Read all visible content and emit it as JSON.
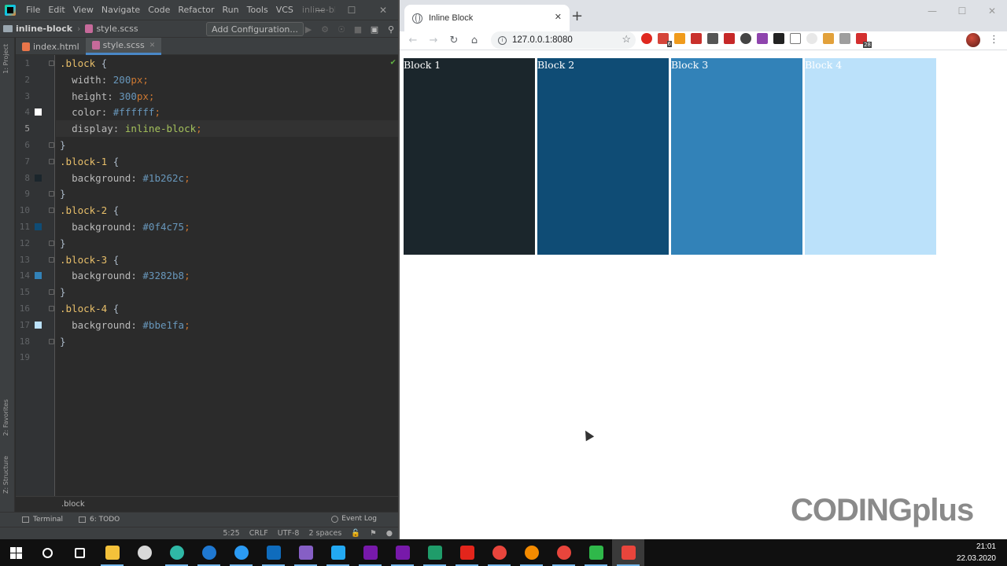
{
  "ide": {
    "menu": [
      "File",
      "Edit",
      "View",
      "Navigate",
      "Code",
      "Refactor",
      "Run",
      "Tools",
      "VCS"
    ],
    "project_title": "inline-bloc",
    "breadcrumb": {
      "project": "inline-block",
      "file": "style.scss"
    },
    "add_configuration": "Add Configuration...",
    "tabs": [
      {
        "label": "index.html",
        "active": false
      },
      {
        "label": "style.scss",
        "active": true
      }
    ],
    "side_tabs": {
      "project": "1: Project",
      "favorites": "2: Favorites",
      "structure": "Z: Structure"
    },
    "code_lines": [
      {
        "n": "1",
        "text": ".block {"
      },
      {
        "n": "2",
        "text": "  width: 200px;"
      },
      {
        "n": "3",
        "text": "  height: 300px;"
      },
      {
        "n": "4",
        "text": "  color: #ffffff;"
      },
      {
        "n": "5",
        "text": "  display: inline-block;"
      },
      {
        "n": "6",
        "text": "}"
      },
      {
        "n": "7",
        "text": ".block-1 {"
      },
      {
        "n": "8",
        "text": "  background: #1b262c;"
      },
      {
        "n": "9",
        "text": "}"
      },
      {
        "n": "10",
        "text": ".block-2 {"
      },
      {
        "n": "11",
        "text": "  background: #0f4c75;"
      },
      {
        "n": "12",
        "text": "}"
      },
      {
        "n": "13",
        "text": ".block-3 {"
      },
      {
        "n": "14",
        "text": "  background: #3282b8;"
      },
      {
        "n": "15",
        "text": "}"
      },
      {
        "n": "16",
        "text": ".block-4 {"
      },
      {
        "n": "17",
        "text": "  background: #bbe1fa;"
      },
      {
        "n": "18",
        "text": "}"
      },
      {
        "n": "19",
        "text": ""
      }
    ],
    "current_line": "5",
    "swatches": [
      {
        "line": "4",
        "color": "#ffffff"
      },
      {
        "line": "8",
        "color": "#1b262c"
      },
      {
        "line": "11",
        "color": "#0f4c75"
      },
      {
        "line": "14",
        "color": "#3282b8"
      },
      {
        "line": "17",
        "color": "#bbe1fa"
      }
    ],
    "code_breadcrumb": ".block",
    "tool_windows": {
      "terminal": "Terminal",
      "todo": "6: TODO",
      "event_log": "Event Log"
    },
    "status": {
      "position": "5:25",
      "line_sep": "CRLF",
      "encoding": "UTF-8",
      "indent": "2 spaces"
    }
  },
  "browser": {
    "tab_title": "Inline Block",
    "address": "127.0.0.1:8080",
    "extension_badges": {
      "ext2": "6",
      "ext18": "28"
    },
    "blocks": [
      {
        "label": "Block 1",
        "color": "#1b262c",
        "text_color": "#ffffff"
      },
      {
        "label": "Block 2",
        "color": "#0f4c75",
        "text_color": "#ffffff"
      },
      {
        "label": "Block 3",
        "color": "#3282b8",
        "text_color": "#ffffff"
      },
      {
        "label": "Block 4",
        "color": "#bbe1fa",
        "text_color": "#ffffff"
      }
    ]
  },
  "watermark": {
    "text": "CODING",
    "suffix": "plus"
  },
  "taskbar": {
    "apps": [
      "search-icon",
      "task-view-icon",
      "file-explorer-icon",
      "app-8-icon",
      "edge-icon",
      "edge-legacy-icon",
      "ie-icon",
      "outlook-icon",
      "visual-studio-icon",
      "vscode-icon",
      "onenote-icon",
      "onenote-2-icon",
      "webstorm-icon",
      "acrobat-icon",
      "chrome-icon",
      "vlc-icon",
      "chrome-2-icon",
      "camtasia-recorder-icon",
      "camtasia-icon"
    ],
    "time": "21:01",
    "date": "22.03.2020"
  }
}
